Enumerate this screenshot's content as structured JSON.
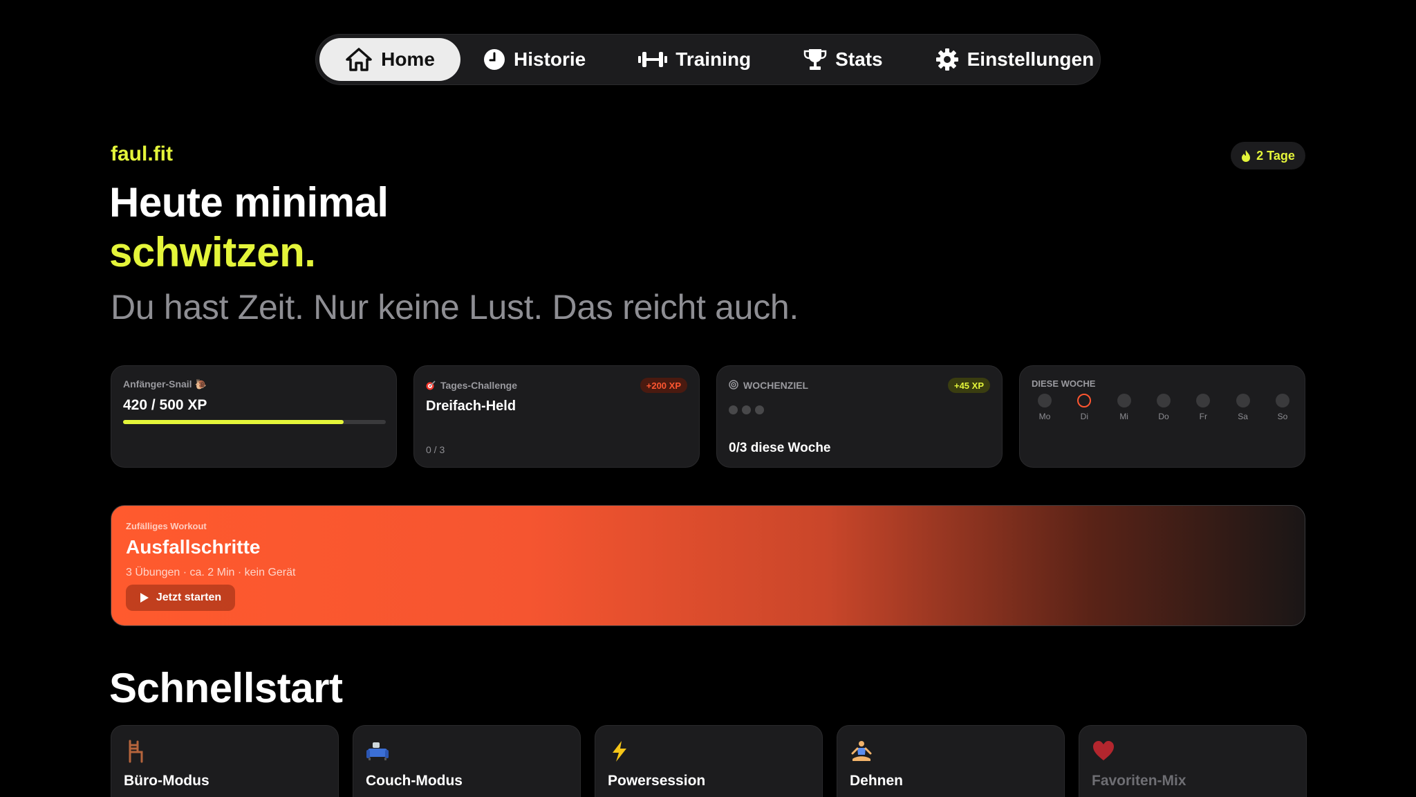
{
  "nav": {
    "items": [
      {
        "label": "Home",
        "icon": "home-icon",
        "active": true
      },
      {
        "label": "Historie",
        "icon": "clock-icon",
        "active": false
      },
      {
        "label": "Training",
        "icon": "dumbbell-icon",
        "active": false
      },
      {
        "label": "Stats",
        "icon": "trophy-icon",
        "active": false
      },
      {
        "label": "Einstellungen",
        "icon": "gear-icon",
        "active": false
      }
    ]
  },
  "header": {
    "brand": "faul.fit",
    "streak": "2 Tage",
    "headline_line1": "Heute minimal",
    "headline_line2": "schwitzen.",
    "subtitle": "Du hast Zeit. Nur keine Lust. Das reicht auch."
  },
  "cards": {
    "level": {
      "label": "Anfänger-Snail 🐌",
      "xp": "420 / 500 XP",
      "progress": 0.84
    },
    "challenge": {
      "label": "Tages-Challenge",
      "badge": "+200 XP",
      "title": "Dreifach-Held",
      "count": "0 / 3"
    },
    "weekly_goal": {
      "label": "WOCHENZIEL",
      "badge": "+45 XP",
      "dots_total": 3,
      "dots_done": 0,
      "text": "0/3 diese Woche"
    },
    "week": {
      "label": "DIESE WOCHE",
      "days": [
        "Mo",
        "Di",
        "Mi",
        "Do",
        "Fr",
        "Sa",
        "So"
      ],
      "today": "Di"
    }
  },
  "banner": {
    "small": "Zufälliges Workout",
    "title": "Ausfallschritte",
    "meta": "3 Übungen · ca. 2 Min · kein Gerät",
    "button": "Jetzt starten"
  },
  "quickstart": {
    "title": "Schnellstart",
    "items": [
      {
        "label": "Büro-Modus",
        "icon": "chair-icon"
      },
      {
        "label": "Couch-Modus",
        "icon": "couch-icon"
      },
      {
        "label": "Powersession",
        "icon": "lightning-icon"
      },
      {
        "label": "Dehnen",
        "icon": "yoga-icon"
      },
      {
        "label": "Favoriten-Mix",
        "icon": "heart-icon"
      }
    ]
  },
  "colors": {
    "accent": "#e4f53a",
    "orange": "#ff5630",
    "background": "#000000",
    "card": "#1c1c1e"
  }
}
